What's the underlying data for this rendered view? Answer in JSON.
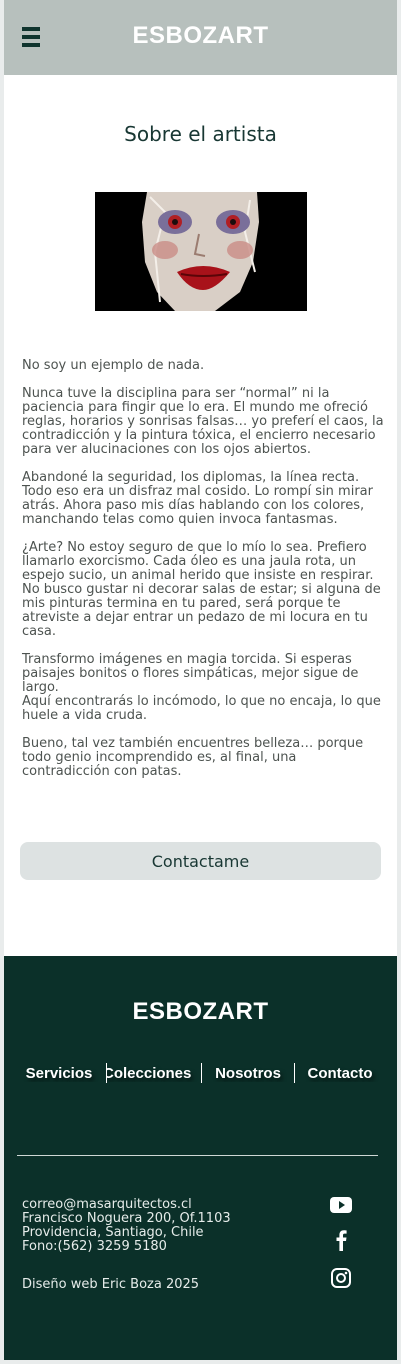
{
  "header": {
    "brand": "ESBOZART"
  },
  "main": {
    "title": "Sobre el artista",
    "paragraphs": [
      "No soy un ejemplo de nada.",
      " Nunca tuve la disciplina para ser “normal” ni la paciencia para fingir que lo era. El mundo me ofreció reglas, horarios y sonrisas falsas… yo preferí el caos, la contradicción y la pintura tóxica, el encierro necesario para ver alucinaciones con los ojos abiertos.",
      "Abandoné la seguridad, los diplomas, la línea recta. Todo eso era un disfraz mal cosido. Lo rompí sin mirar atrás. Ahora paso mis días hablando con los colores, manchando telas como quien invoca fantasmas.",
      "¿Arte? No estoy seguro de que lo mío lo sea. Prefiero llamarlo exorcismo. Cada óleo es una jaula rota, un espejo sucio, un animal herido que insiste en respirar. No busco gustar ni decorar salas de estar; si alguna de mis pinturas termina en tu pared, será porque te atreviste a dejar entrar un pedazo de mi locura en tu casa.",
      "Transformo imágenes en magia torcida. Si esperas paisajes bonitos o flores simpáticas, mejor sigue de largo.\n Aquí encontrarás lo incómodo, lo que no encaja, lo que huele a vida cruda.",
      "Bueno, tal vez también encuentres belleza… porque todo genio incomprendido es, al final, una contradicción con patas."
    ],
    "contact_button": "Contactame"
  },
  "footer": {
    "brand": "ESBOZART",
    "nav": [
      "Servicios",
      "Colecciones",
      "Nosotros",
      "Contacto"
    ],
    "email": "correo@masarquitectos.cl",
    "address1": "Francisco Noguera 200, Of.1103",
    "address2": "Providencia, Santiago, Chile",
    "phone": "Fono:(562) 3259 5180",
    "credit": "Diseño web Eric Boza 2025"
  },
  "icons": {
    "menu": "hamburger-menu-icon",
    "youtube": "youtube-icon",
    "facebook": "facebook-icon",
    "instagram": "instagram-icon"
  },
  "colors": {
    "header_bg": "#b7c0bd",
    "footer_bg": "#0b3029",
    "button_bg": "#dde2e2",
    "dark_text": "#183733"
  }
}
